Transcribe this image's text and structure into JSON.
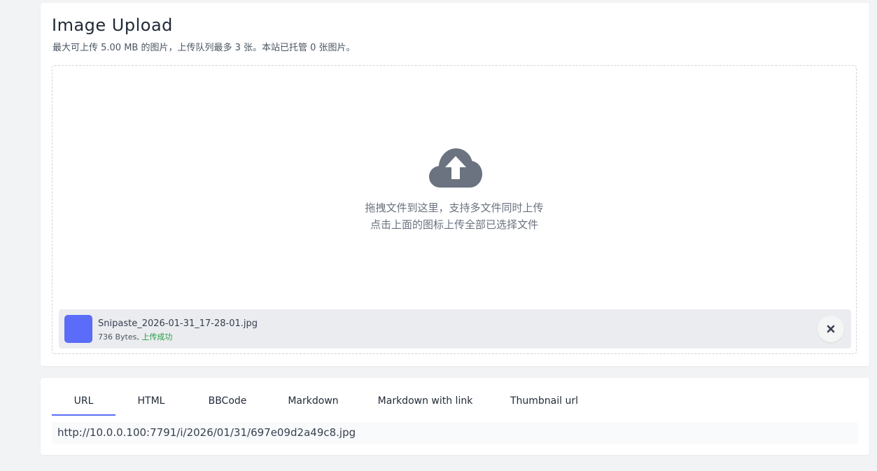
{
  "upload": {
    "title": "Image Upload",
    "subtitle": "最大可上传 5.00 MB 的图片，上传队列最多 3 张。本站已托管 0 张图片。",
    "hint_line1": "拖拽文件到这里，支持多文件同时上传",
    "hint_line2": "点击上面的图标上传全部已选择文件",
    "file": {
      "name": "Snipaste_2026-01-31_17-28-01.jpg",
      "size": "736 Bytes,",
      "status": "上传成功"
    }
  },
  "links": {
    "tabs": [
      {
        "label": "URL"
      },
      {
        "label": "HTML"
      },
      {
        "label": "BBCode"
      },
      {
        "label": "Markdown"
      },
      {
        "label": "Markdown with link"
      },
      {
        "label": "Thumbnail url"
      }
    ],
    "active_tab": "URL",
    "output": "http://10.0.0.100:7791/i/2026/01/31/697e09d2a49c8.jpg"
  },
  "icons": {
    "upload": "cloud-upload-icon",
    "remove": "close-icon"
  },
  "colors": {
    "accent": "#5b6cf9",
    "success": "#22a047",
    "icon_gray": "#6b7280",
    "file_bg": "#ebecef"
  }
}
